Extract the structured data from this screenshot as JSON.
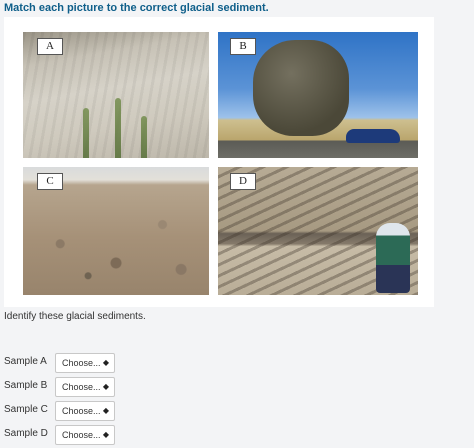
{
  "question": {
    "title": "Match each picture to the correct glacial sediment.",
    "instructions": "Identify these glacial sediments."
  },
  "photos": [
    {
      "label": "A"
    },
    {
      "label": "B"
    },
    {
      "label": "C"
    },
    {
      "label": "D"
    }
  ],
  "rows": [
    {
      "label": "Sample A",
      "selected": "Choose..."
    },
    {
      "label": "Sample B",
      "selected": "Choose..."
    },
    {
      "label": "Sample C",
      "selected": "Choose..."
    },
    {
      "label": "Sample D",
      "selected": "Choose..."
    }
  ],
  "icons": {
    "select_caret": "up-down-caret-icon"
  }
}
